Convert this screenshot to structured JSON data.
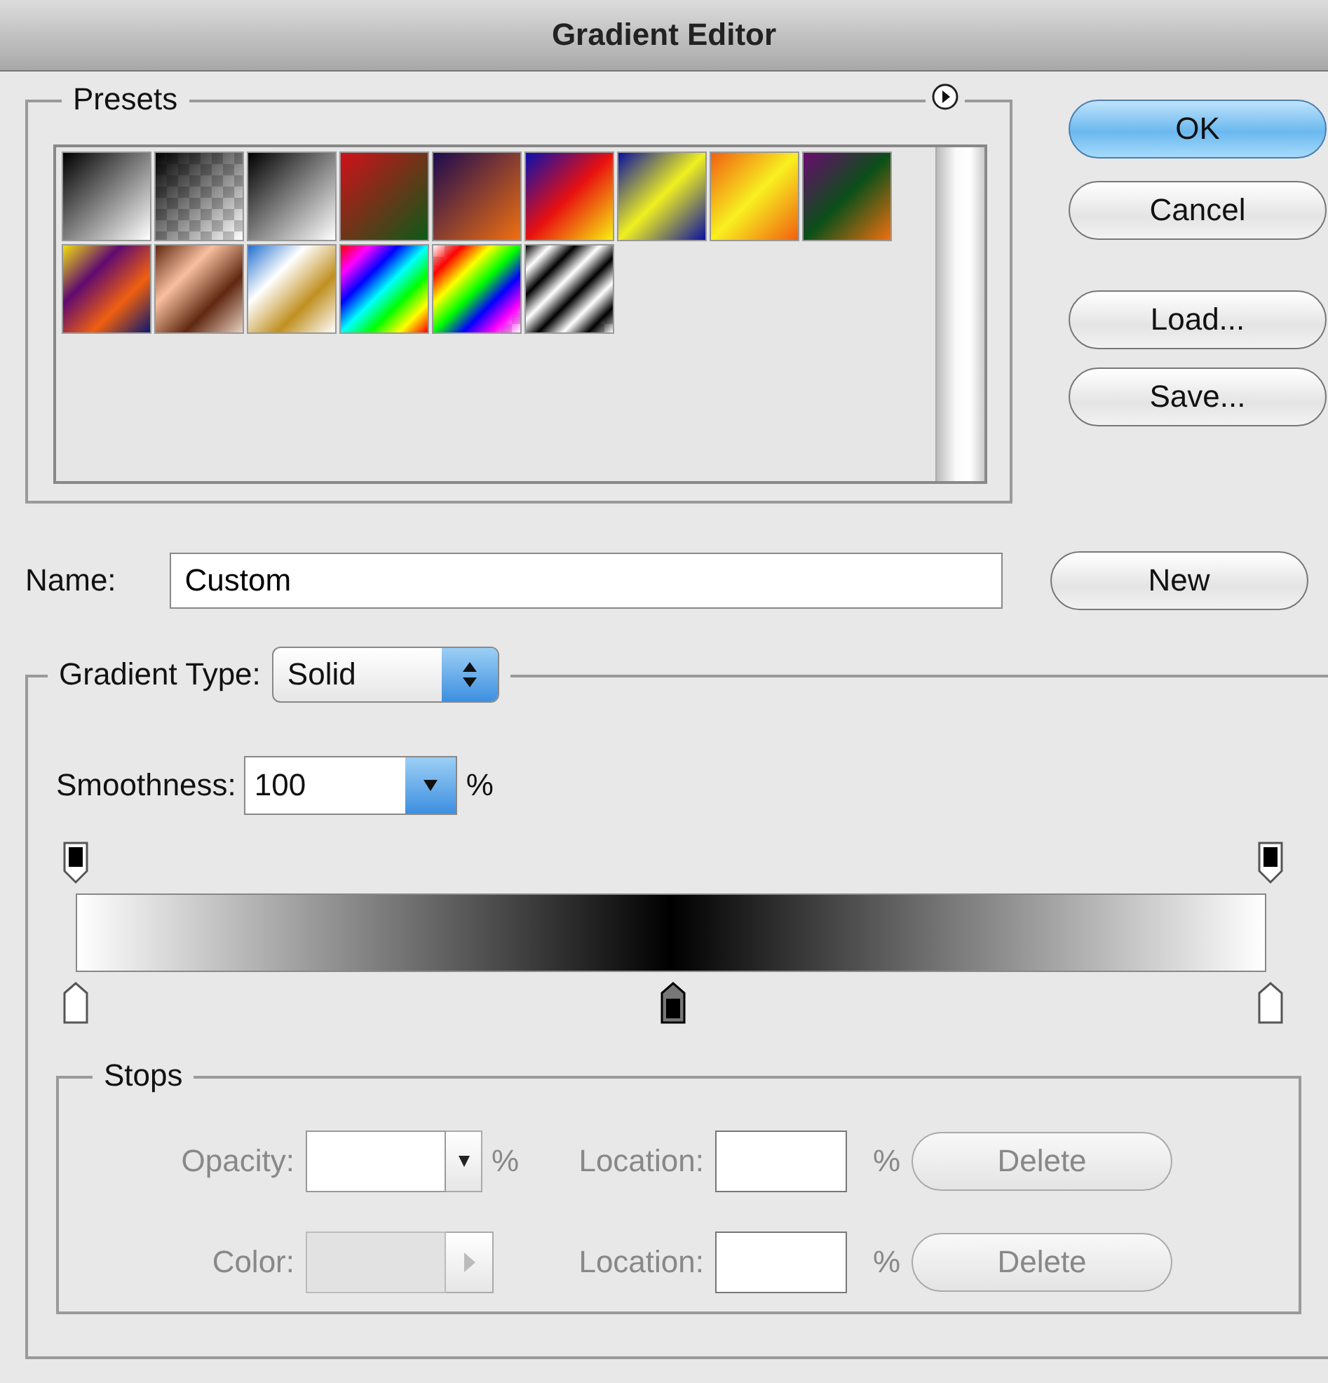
{
  "window": {
    "title": "Gradient Editor"
  },
  "presets": {
    "label": "Presets"
  },
  "buttons": [
    {
      "label": "OK",
      "default": true
    },
    {
      "label": "Cancel",
      "default": false
    },
    {
      "label": "Load...",
      "default": false
    },
    {
      "label": "Save...",
      "default": false
    }
  ],
  "name": {
    "label": "Name:",
    "value": "Custom",
    "button": "New"
  },
  "gradient_type": {
    "label": "Gradient Type:",
    "value": "Solid"
  },
  "smoothness": {
    "label": "Smoothness:",
    "value": "100",
    "unit": "%"
  },
  "opacity_stops": [
    {
      "color": "#000000",
      "selected": false
    },
    {
      "color": "#000000",
      "selected": false
    }
  ],
  "color_stops": [
    {
      "color": "#ffffff",
      "selected": false
    },
    {
      "color": "#000000",
      "selected": true
    },
    {
      "color": "#ffffff",
      "selected": false
    }
  ],
  "stops": {
    "label": "Stops",
    "rows": [
      {
        "kind": "opacity",
        "label": "Opacity:",
        "unit": "%",
        "location_label": "Location:",
        "location_unit": "%",
        "button": "Delete",
        "disabled": true
      },
      {
        "kind": "color",
        "label": "Color:",
        "location_label": "Location:",
        "location_unit": "%",
        "button": "Delete",
        "disabled": true
      }
    ]
  }
}
